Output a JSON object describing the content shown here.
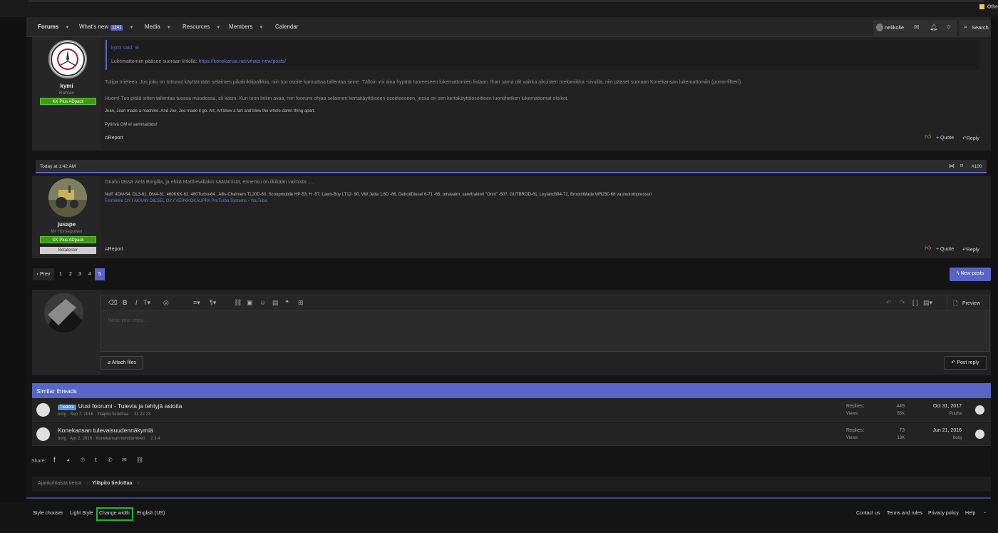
{
  "browser": {
    "bookmark_other": "Othe"
  },
  "nav": {
    "forums": "Forums",
    "whats_new": "What's new",
    "whats_new_count": "1241",
    "media": "Media",
    "resources": "Resources",
    "members": "Members",
    "calendar": "Calendar",
    "username": "nelikolie",
    "search": "Search"
  },
  "post1": {
    "user": {
      "name": "kymi",
      "title": "Rahtari",
      "banner": "KK Plus ADpack"
    },
    "quote_author": "kymi said:",
    "quote_text": "Lukemattomiin pääsee suoraan linkillä:",
    "quote_link": "https://konekansa.net/whats-new/posts/",
    "para1": "Tulipa mieleen. Jos joku on tottunut käyttämään selaimen pikalinkkipalkkia, niin tuo osoite kannattaa tallentaa sinne. Tällöin voi aina hypätä tuoreeseen lukemattomien listaan. Ihan sama olit vaikka aikuisten mekaniikka -sivuilla, niin pääset suoraan Konekansan lukemattomiin (pomo-filtteri).",
    "para2": "Huom! Tuo pitää sitten tallentaa tuossa muodossa, eli käsin. Kun tuon linkin avaa, niin foorumi ohjaa selaimen kertakäyttöiseen osoitteeseen, jossa on sen kertakäyttöosoitteen luontihetken lukemattomat otsikot.",
    "sig1": "Jean, Jean made a machine. And Joe, Joe made it go. Art, Art blew a fart and blew the whole damn thing apart.",
    "sig2": "Pyörivä OM ei sammaloidu!",
    "report": "Report",
    "quote": "Quote",
    "reply": "Reply"
  },
  "post2": {
    "date": "Today at 1:42 AM",
    "number": "#100",
    "user": {
      "name": "jusape",
      "title": "Mr Horsepower",
      "banner": "KK Plus ADpack",
      "banner2": "Betatester"
    },
    "text": "Onahn tässä vielä Borgilla, ja ehkä Matthewillakin säätämistä, ennenku on ilkikään valmista .....",
    "sig1": "Nuff: 4DM-54, DL3-61, DM4-61, 460KKK-62, 460Turbo-64 , Allis-Chalmers TL20D-60, Scoopmobile HP-53, H -57, Lawn-Boy LT12- 90, VW Jetta 1,6D -86, DetroitDiesel 6-71 -65, omavalm. sarvitraktori \"Onni\" -50?, GUTBROD-61, Leyland384-72, BroomWade WR250-68 vaunukompressori",
    "sig2a": "Fermikkie OY",
    "sig2b": "AKAAN DIESEL OY",
    "sig2c": "VERKKOKAUPPA ProTurbo Systems",
    "sig2d": "YouTube",
    "report": "Report",
    "quote": "Quote",
    "reply": "Reply"
  },
  "pagination": {
    "prev": "Prev",
    "pages": [
      "1",
      "2",
      "3",
      "4",
      "5"
    ],
    "current": "5",
    "new_posts": "New posts"
  },
  "editor": {
    "placeholder": "Write your reply...",
    "preview": "Preview",
    "attach": "Attach files",
    "post_reply": "Post reply"
  },
  "similar": {
    "heading": "Similar threads",
    "labels": {
      "replies": "Replies:",
      "views": "Views:"
    },
    "threads": [
      {
        "prefix": "Tiedote",
        "title": "Uusi foorumi - Tulevia ja tehtyjä asioita",
        "meta": "borg · Sep 7, 2016 · Ylläpito tiedottaa",
        "pages": "21  22  23",
        "replies": "449",
        "views": "55K",
        "date": "Oct 31, 2017",
        "last_user": "Puuha"
      },
      {
        "prefix": "",
        "title": "Konekansan tulevaisuudennäkymiä",
        "meta": "borg · Apr 2, 2016 · Konekansan kehittäminen",
        "pages": "2  3  4",
        "replies": "73",
        "views": "13K",
        "date": "Jun 21, 2016",
        "last_user": "borg"
      }
    ]
  },
  "share": {
    "label": "Share:"
  },
  "breadcrumb": {
    "first": "Ajankohtaista tietoa",
    "second": "Ylläpito tiedottaa"
  },
  "footer": {
    "style_chooser": "Style chooser",
    "light_style": "Light Style",
    "change_width": "Change width",
    "language": "English (US)",
    "contact": "Contact us",
    "terms": "Terms and rules",
    "privacy": "Privacy policy",
    "help": "Help"
  },
  "colors": {
    "accent": "#5865c4",
    "green_banner": "#3f9b15",
    "link": "#6b78d9",
    "highlight": "#1fb34a"
  }
}
